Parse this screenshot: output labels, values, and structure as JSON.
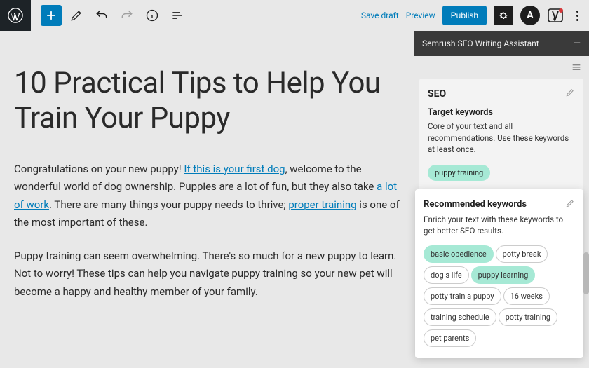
{
  "topbar": {
    "save_draft": "Save draft",
    "preview": "Preview",
    "publish": "Publish"
  },
  "post": {
    "title": "10 Practical Tips to Help You Train Your Puppy",
    "p1_a": "Congratulations on your new puppy! ",
    "p1_link1": "If this is your first dog",
    "p1_b": ", welcome to the wonderful world of dog ownership. Puppies are a lot of fun, but they also take ",
    "p1_link2": "a lot of work",
    "p1_c": ". There are many things your puppy needs to thrive; ",
    "p1_link3": "proper training",
    "p1_d": " is one of the most important of these.",
    "p2": "Puppy training can seem overwhelming. There's so much for a new puppy to learn. Not to worry! These tips can help you navigate puppy training so your new pet will become a happy and healthy member of your family."
  },
  "sidebar": {
    "header": "Semrush SEO Writing Assistant",
    "seo_title": "SEO",
    "target_label": "Target keywords",
    "target_desc": "Core of your text and all recommendations. Use these keywords at least once.",
    "target_chip": "puppy training"
  },
  "popup": {
    "title": "Recommended keywords",
    "desc": "Enrich your text with these keywords to get better SEO results.",
    "chips": [
      {
        "label": "basic obedience",
        "hl": true
      },
      {
        "label": "potty break",
        "hl": false
      },
      {
        "label": "dog s life",
        "hl": false
      },
      {
        "label": "puppy learning",
        "hl": true
      },
      {
        "label": "potty train a puppy",
        "hl": false
      },
      {
        "label": "16 weeks",
        "hl": false
      },
      {
        "label": "training schedule",
        "hl": false
      },
      {
        "label": "potty training",
        "hl": false
      },
      {
        "label": "pet parents",
        "hl": false
      }
    ]
  }
}
